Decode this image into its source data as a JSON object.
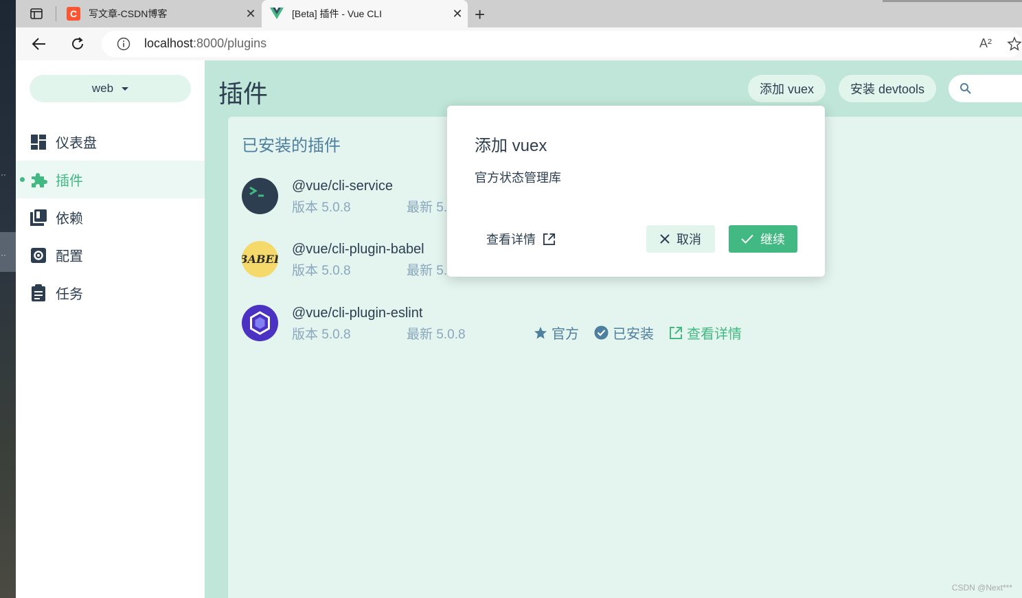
{
  "browser": {
    "tabs": [
      {
        "title": "写文章-CSDN博客",
        "favicon": "csdn-logo",
        "favicon_letter": "C"
      },
      {
        "title": "[Beta] 插件 - Vue CLI",
        "favicon": "vue-logo"
      }
    ],
    "url": {
      "host": "localhost",
      "path": ":8000/plugins"
    },
    "read_aloud": "A²"
  },
  "sidebar": {
    "project": "web",
    "items": [
      {
        "label": "仪表盘",
        "icon": "dashboard-icon"
      },
      {
        "label": "插件",
        "icon": "puzzle-icon",
        "active": true
      },
      {
        "label": "依赖",
        "icon": "library-icon"
      },
      {
        "label": "配置",
        "icon": "settings-icon"
      },
      {
        "label": "任务",
        "icon": "clipboard-icon"
      }
    ]
  },
  "header": {
    "title": "插件",
    "add_vuex": "添加 vuex",
    "install_devtools": "安装 devtools"
  },
  "panel": {
    "title": "已安装的插件",
    "plugins": [
      {
        "name": "@vue/cli-service",
        "version": "版本 5.0.8",
        "latest": "最新 5.",
        "logo": "vue-cli-service-logo"
      },
      {
        "name": "@vue/cli-plugin-babel",
        "version": "版本 5.0.8",
        "latest": "最新 5.",
        "logo": "babel-logo"
      },
      {
        "name": "@vue/cli-plugin-eslint",
        "version": "版本 5.0.8",
        "latest": "最新 5.0.8",
        "logo": "eslint-logo",
        "official": "官方",
        "installed": "已安装",
        "details": "查看详情"
      }
    ]
  },
  "modal": {
    "title": "添加 vuex",
    "description": "官方状态管理库",
    "details": "查看详情",
    "cancel": "取消",
    "continue": "继续"
  },
  "colors": {
    "accent": "#42b983",
    "main_bg": "#bfe6d8",
    "panel_bg": "#e4f4ee",
    "pill_bg": "#e1f5ec",
    "text": "#2c3e50",
    "muted": "#4f7f9f"
  },
  "watermark": "CSDN @Next***"
}
